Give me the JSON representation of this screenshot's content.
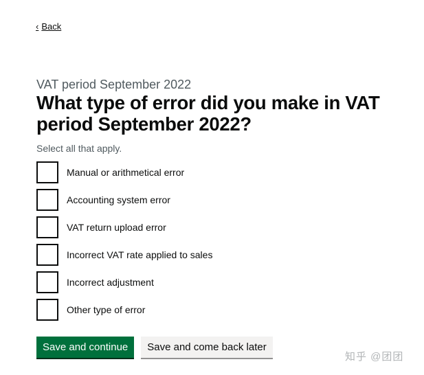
{
  "back": {
    "label": "Back"
  },
  "caption": "VAT period September 2022",
  "heading": "What type of error did you make in VAT period September 2022?",
  "hint": "Select all that apply.",
  "options": [
    {
      "label": "Manual or arithmetical error",
      "checked": false
    },
    {
      "label": "Accounting system error",
      "checked": false
    },
    {
      "label": "VAT return upload error",
      "checked": false
    },
    {
      "label": "Incorrect VAT rate applied to sales",
      "checked": false
    },
    {
      "label": "Incorrect adjustment",
      "checked": false
    },
    {
      "label": "Other type of error",
      "checked": false
    }
  ],
  "buttons": {
    "primary": "Save and continue",
    "secondary": "Save and come back later"
  },
  "watermark": "知乎 @团团",
  "colors": {
    "primary_button": "#00703c",
    "secondary_button": "#f3f2f1",
    "text": "#0b0c0c",
    "secondary_text": "#505a5f"
  }
}
